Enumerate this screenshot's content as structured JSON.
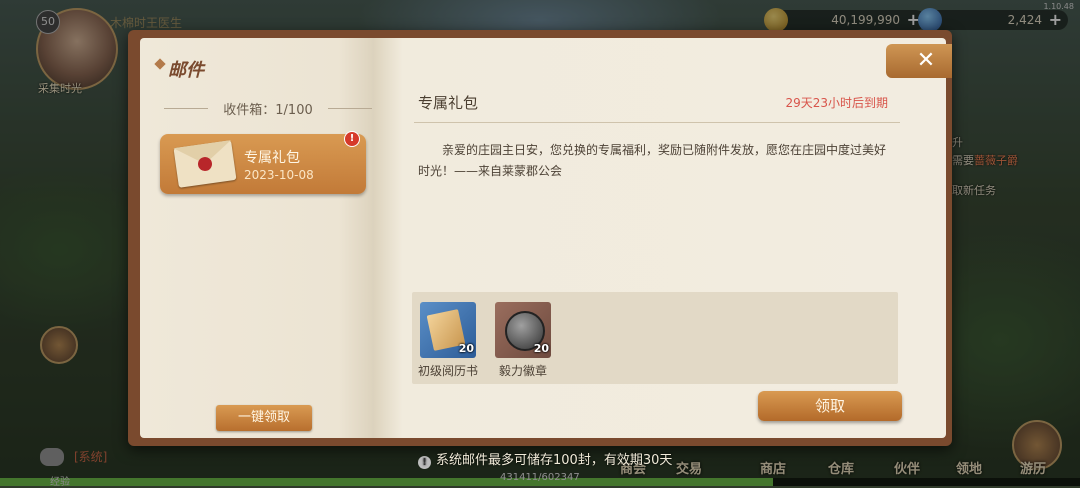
{
  "hud": {
    "level": "50",
    "player_name": "采集时光",
    "player_title": "木棉时王医生",
    "gold": "40,199,990",
    "gems": "2,424",
    "version": "1.10.48",
    "side_task_line1": "需要",
    "side_task_highlight": "蔷薇子爵",
    "side_task_line2": "取新任务",
    "side_label": "升",
    "chat_text": "[系统]",
    "exp_label": "经验",
    "exp_value": "431411/602347",
    "exp_fraction": 0.716,
    "nav": [
      "商会",
      "交易",
      "商店",
      "仓库",
      "伙伴",
      "领地",
      "游历"
    ]
  },
  "mail": {
    "window_title": "邮件",
    "inbox_count": "收件箱：1/100",
    "items": [
      {
        "title": "专属礼包",
        "date": "2023-10-08",
        "badge": "!"
      }
    ],
    "claim_all_label": "一键领取",
    "detail": {
      "title": "专属礼包",
      "expires": "29天23小时后到期",
      "body": "亲爱的庄园主日安，您兑换的专属福利，奖励已随附件发放，愿您在庄园中度过美好时光！——来自莱蒙郡公会",
      "attachments": [
        {
          "name": "初级阅历书",
          "count": "20",
          "icon": "scroll-book-icon"
        },
        {
          "name": "毅力徽章",
          "count": "20",
          "icon": "iron-badge-icon"
        }
      ],
      "claim_label": "领取"
    },
    "close_icon": "✕",
    "notice": "系统邮件最多可储存100封，有效期30天"
  }
}
